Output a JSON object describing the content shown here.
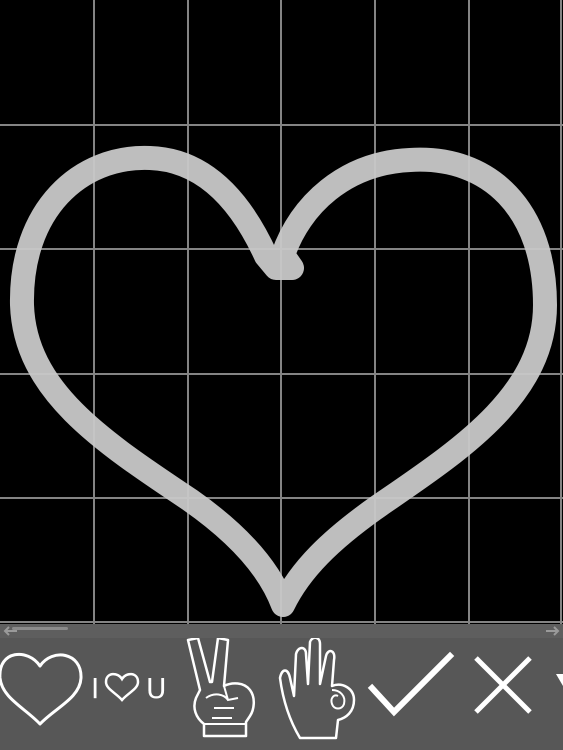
{
  "canvas": {
    "background_color": "#000000",
    "grid_color": "#8c8c8c",
    "stroke_color": "#c8c8c8",
    "drawing": "heart-outline"
  },
  "toolbar": {
    "background_color": "#575757",
    "stamps": [
      {
        "name": "heart-stamp",
        "icon": "heart-outline-icon"
      },
      {
        "name": "i-love-you-stamp",
        "icon": "i-love-you-icon",
        "text_left": "I",
        "text_right": "U"
      },
      {
        "name": "peace-hand-stamp",
        "icon": "peace-sign-hand-icon"
      },
      {
        "name": "ok-hand-stamp",
        "icon": "ok-sign-hand-icon"
      },
      {
        "name": "checkmark-stamp",
        "icon": "checkmark-icon"
      },
      {
        "name": "cross-stamp",
        "icon": "x-mark-icon"
      },
      {
        "name": "more-stamp",
        "icon": "triangle-down-icon"
      }
    ]
  },
  "scrollbar": {
    "left_arrow_icon": "arrow-left-icon",
    "right_arrow_icon": "arrow-right-icon"
  }
}
